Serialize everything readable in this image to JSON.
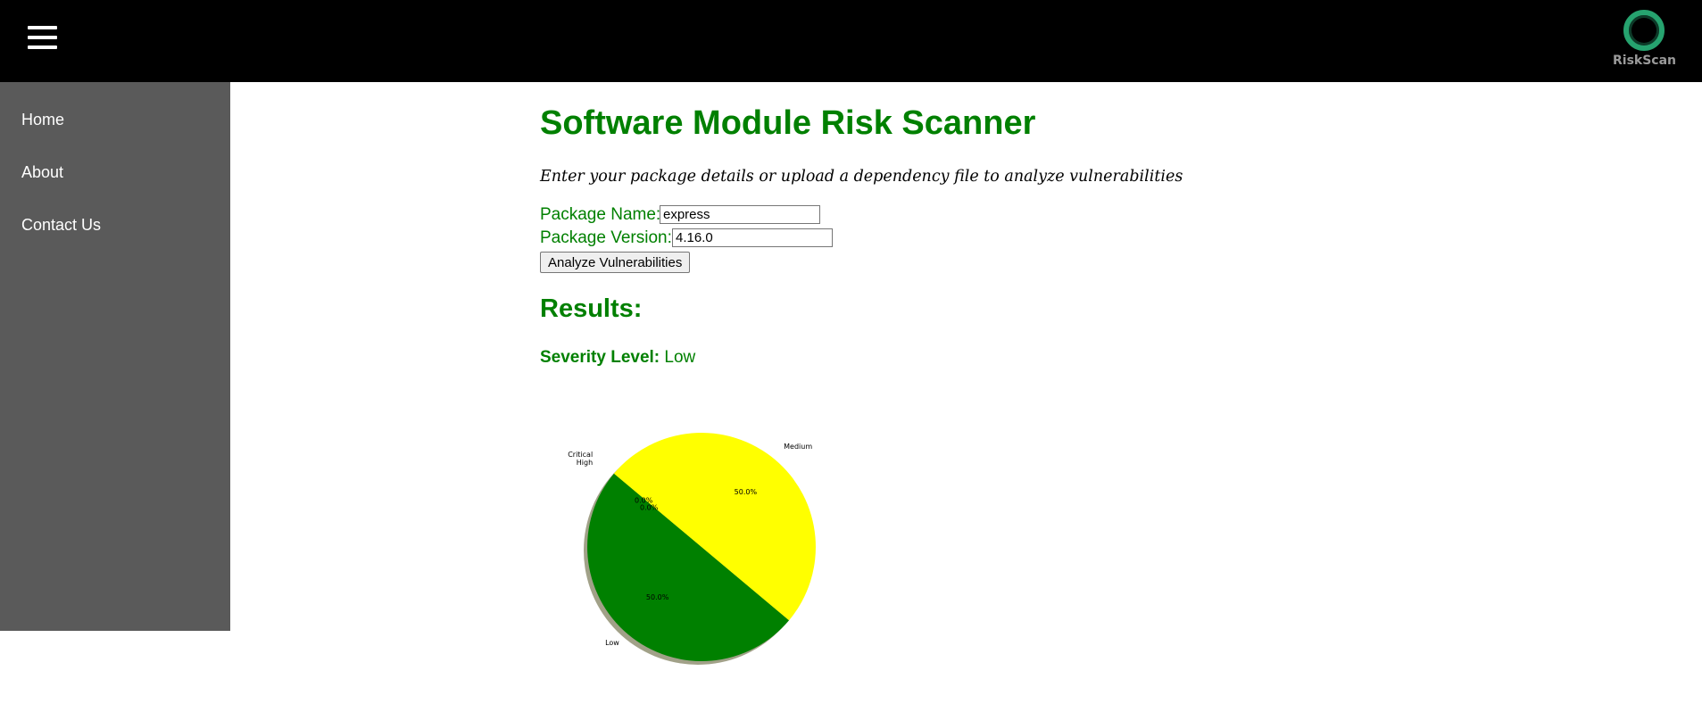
{
  "app": {
    "logo_text": "RiskScan",
    "accent_color": "#008000",
    "logo_color": "#26a36f"
  },
  "header": {
    "menu_icon": "hamburger-menu-icon"
  },
  "sidebar": {
    "items": [
      {
        "label": "Home"
      },
      {
        "label": "About"
      },
      {
        "label": "Contact Us"
      }
    ]
  },
  "main": {
    "title": "Software Module Risk Scanner",
    "subtitle": "Enter your package details or upload a dependency file to analyze vulnerabilities",
    "package_name_label": "Package Name:",
    "package_name_value": "express",
    "package_version_label": "Package Version:",
    "package_version_value": "4.16.0",
    "analyze_button": "Analyze Vulnerabilities",
    "results_heading": "Results:",
    "severity_label": "Severity Level:",
    "severity_value": "Low"
  },
  "chart_data": {
    "type": "pie",
    "categories": [
      "Low",
      "Medium",
      "High",
      "Critical"
    ],
    "values": [
      50.0,
      50.0,
      0.0,
      0.0
    ],
    "labels_pct": [
      "50.0%",
      "50.0%",
      "0.0%",
      "0.0%"
    ],
    "colors": [
      "#008000",
      "#ffff00",
      "#ff8c00",
      "#ff0000"
    ],
    "shadow": true
  }
}
